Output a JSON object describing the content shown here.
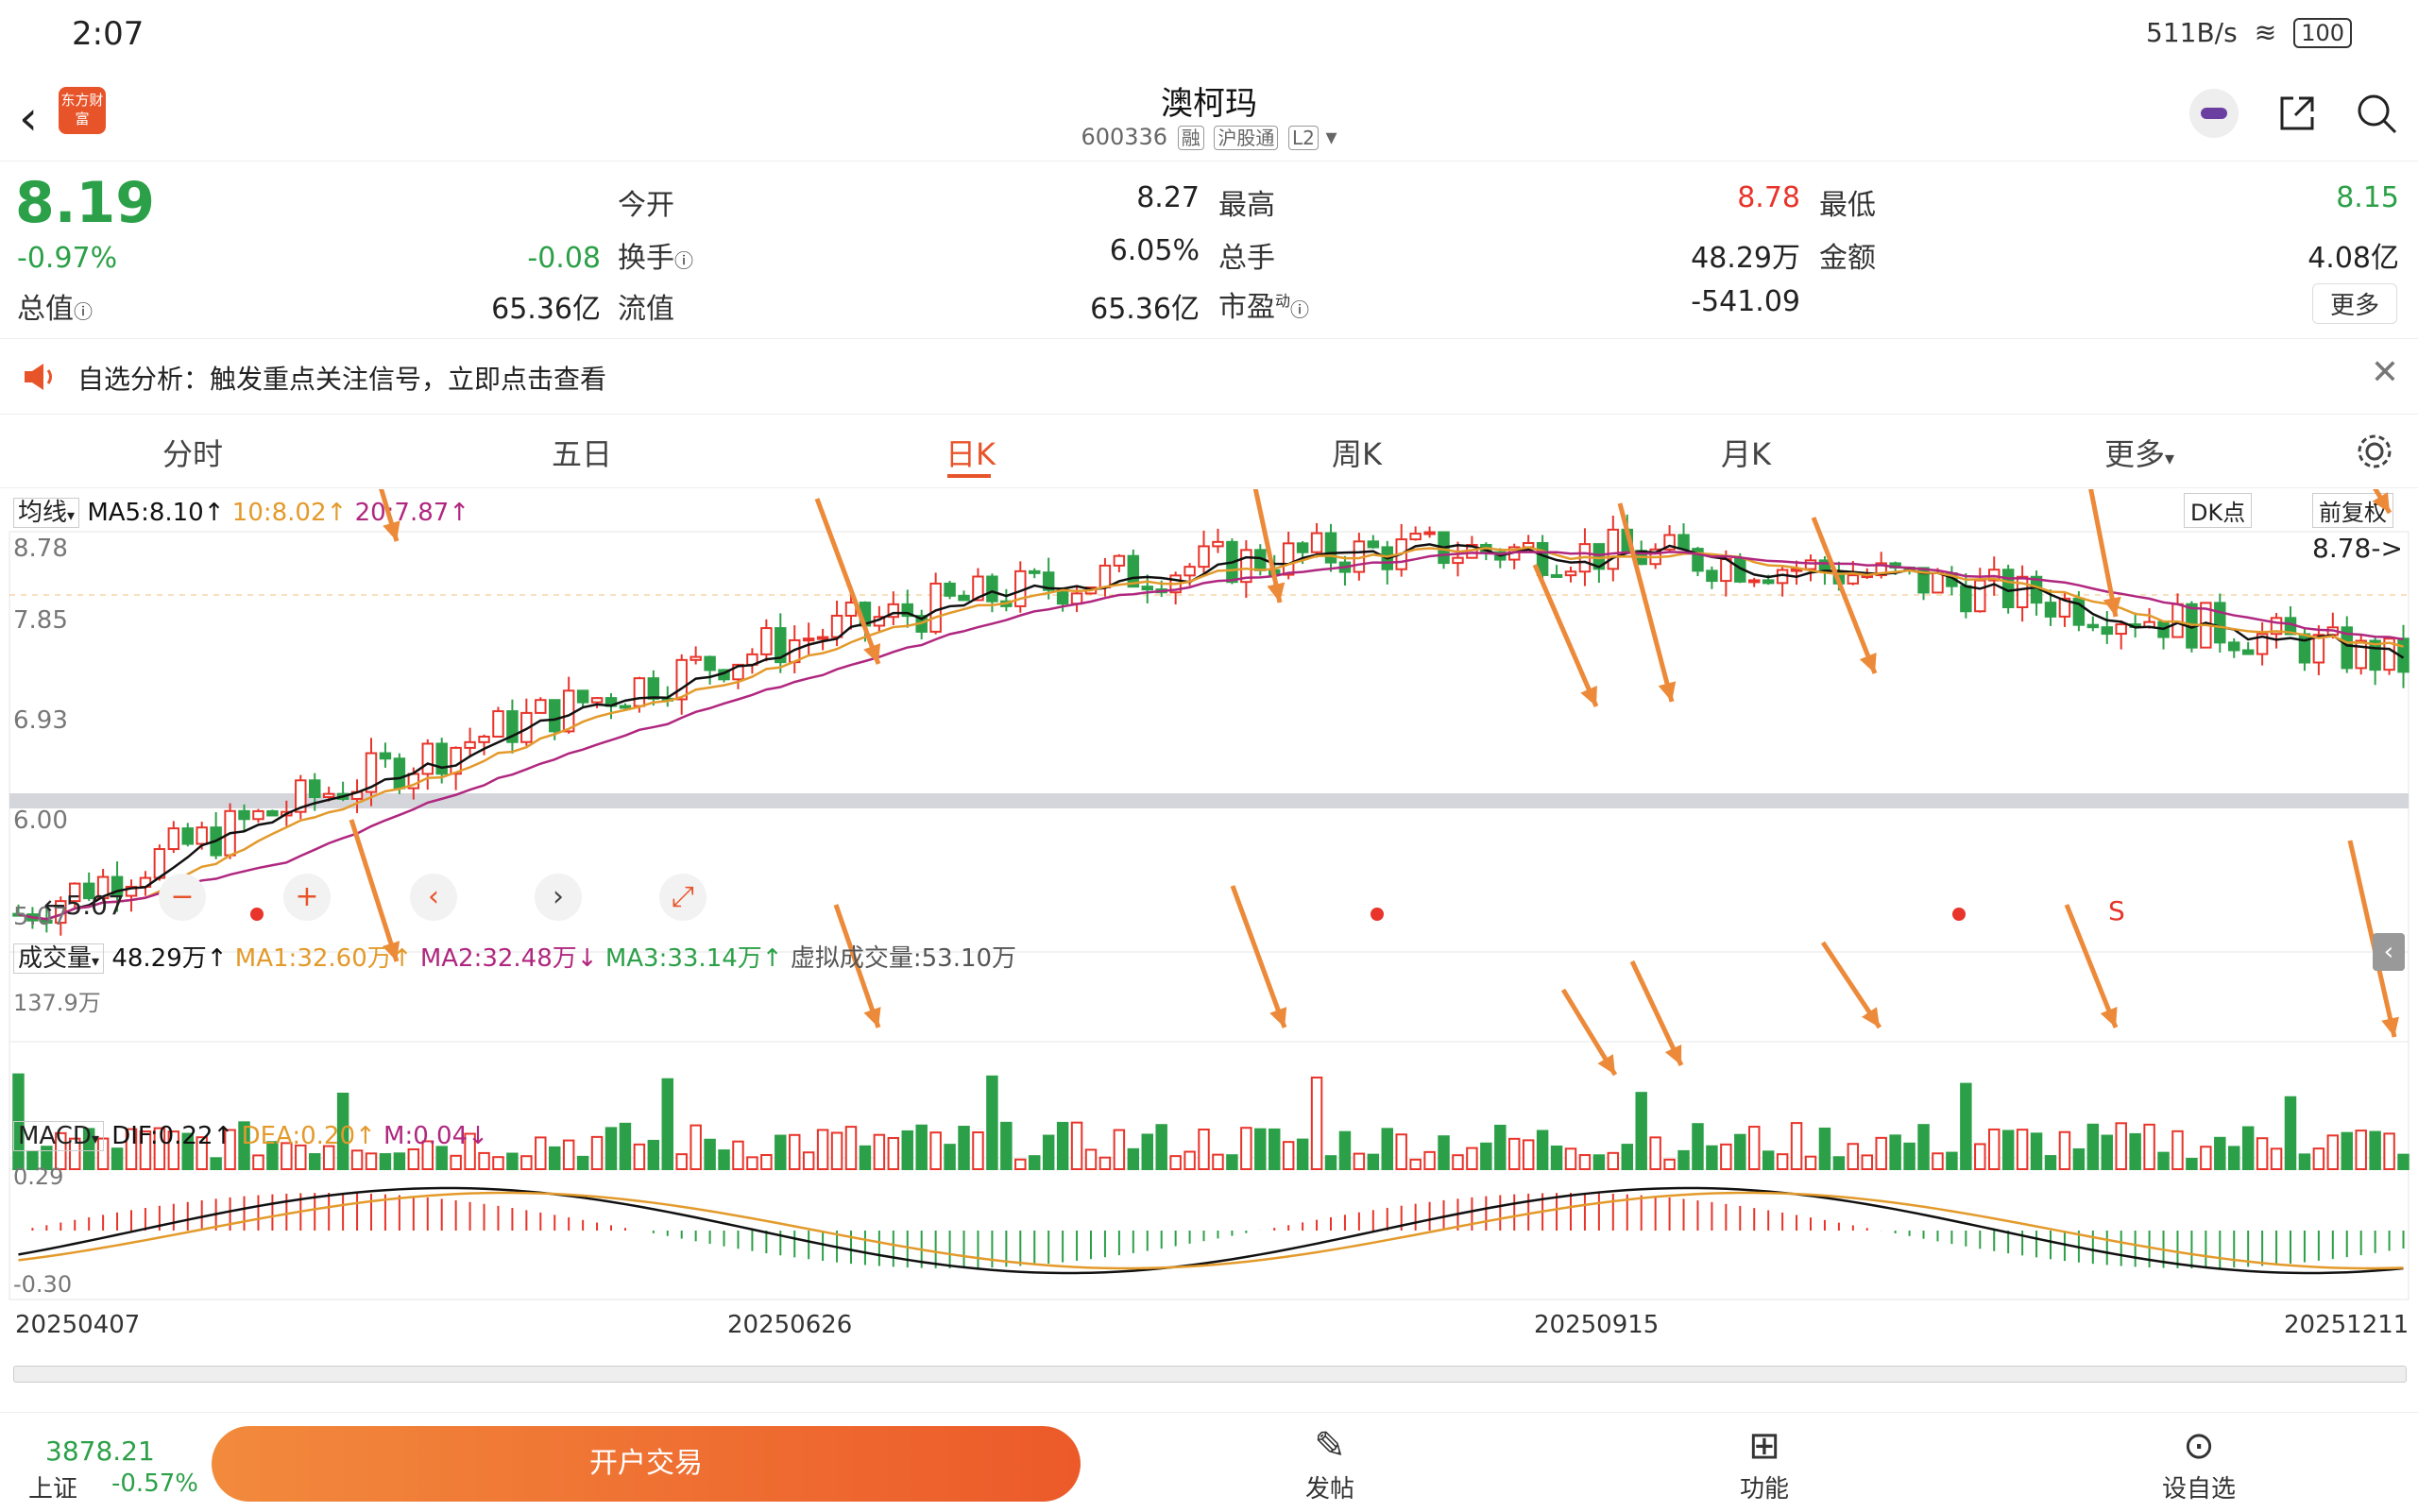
{
  "status": {
    "time": "2:07",
    "net_speed": "511B/s",
    "battery": "100"
  },
  "header": {
    "back_icon": "chevron-left-icon",
    "logo_text": "东方财富",
    "title": "澳柯玛",
    "code": "600336",
    "tags": [
      "融",
      "沪股通",
      "L2"
    ]
  },
  "quote": {
    "price": "8.19",
    "pct": "-0.97%",
    "chg": "-0.08",
    "open_label": "今开",
    "open": "8.27",
    "high_label": "最高",
    "high": "8.78",
    "low_label": "最低",
    "low": "8.15",
    "turnover_label": "换手",
    "turnover": "6.05%",
    "volume_label": "总手",
    "volume": "48.29万",
    "amount_label": "金额",
    "amount": "4.08亿",
    "mcap_label": "总值",
    "mcap": "65.36亿",
    "float_label": "流值",
    "float": "65.36亿",
    "pe_label": "市盈",
    "pe_sup": "动",
    "pe": "-541.09",
    "more": "更多"
  },
  "notice": {
    "text": "自选分析：触发重点关注信号，立即点击查看"
  },
  "tabs": [
    "分时",
    "五日",
    "日K",
    "周K",
    "月K",
    "更多"
  ],
  "kline": {
    "ma_selector": "均线",
    "ma5": "MA5:8.10↑",
    "ma10": "10:8.02↑",
    "ma20": "20:7.87↑",
    "dk_label": "DK点",
    "adjust_label": "前复权",
    "y_top": "8.78",
    "y_2": "7.85",
    "y_3": "6.93",
    "y_4": "6.00",
    "y_low": "5.07",
    "low_marker": "←5.07",
    "high_marker": "8.78->",
    "s_marker": "S"
  },
  "volume": {
    "selector": "成交量",
    "vol": "48.29万↑",
    "ma1": "MA1:32.60万↑",
    "ma2": "MA2:32.48万↓",
    "ma3": "MA3:33.14万↑",
    "virtual": "虚拟成交量:53.10万",
    "y_top": "137.9万"
  },
  "macd": {
    "selector": "MACD",
    "dif": "DIF:0.22↑",
    "dea": "DEA:0.20↑",
    "m": "M:0.04↓",
    "y_top": "0.29",
    "y_bottom": "-0.30"
  },
  "dates": [
    "20250407",
    "20250626",
    "20250915",
    "20251211"
  ],
  "index": {
    "value": "3878.21",
    "name": "上证",
    "pct": "-0.57%"
  },
  "bottom": {
    "trade": "开户交易",
    "post": "发帖",
    "func": "功能",
    "watch": "设自选"
  },
  "colors": {
    "up": "#e8342a",
    "down": "#2ca048",
    "accent": "#e8542a",
    "ma5": "#111111",
    "ma10": "#e39a2b",
    "ma20": "#b0277f"
  }
}
